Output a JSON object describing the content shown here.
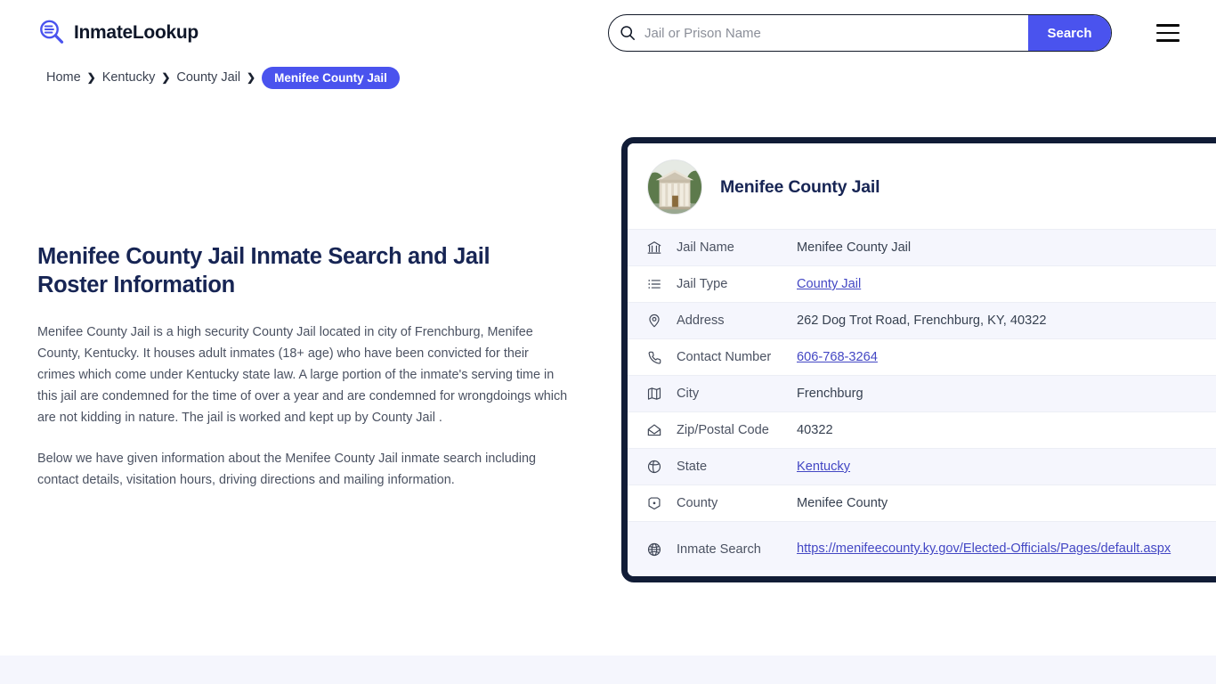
{
  "header": {
    "logo_text": "InmateLookup",
    "logo_icon": "magnifier-list-icon",
    "menu_icon": "hamburger-menu-icon"
  },
  "search": {
    "placeholder": "Jail or Prison Name",
    "value": "",
    "button_label": "Search",
    "icon": "search-icon"
  },
  "breadcrumb": {
    "items": [
      {
        "label": "Home"
      },
      {
        "label": "Kentucky"
      },
      {
        "label": "County Jail"
      }
    ],
    "separator": "❯",
    "current": "Menifee County Jail"
  },
  "main": {
    "title": "Menifee County Jail Inmate Search and Jail Roster Information",
    "paragraph_1": "Menifee County Jail is a high security County Jail located in city of Frenchburg, Menifee County, Kentucky. It houses adult inmates (18+ age) who have been convicted for their crimes which come under Kentucky state law. A large portion of the inmate's serving time in this jail are condemned for the time of over a year and are condemned for wrongdoings which are not kidding in nature. The jail is worked and kept up by County Jail .",
    "paragraph_2": "Below we have given information about the Menifee County Jail inmate search including contact details, visitation hours, driving directions and mailing information."
  },
  "info_card": {
    "title": "Menifee County Jail",
    "thumbnail_icon": "courthouse-photo",
    "rows": [
      {
        "icon": "bank-icon",
        "label": "Jail Name",
        "value": "Menifee County Jail",
        "link": false
      },
      {
        "icon": "list-icon",
        "label": "Jail Type",
        "value": "County Jail",
        "link": true
      },
      {
        "icon": "map-pin-icon",
        "label": "Address",
        "value": "262 Dog Trot Road, Frenchburg, KY, 40322",
        "link": false
      },
      {
        "icon": "phone-icon",
        "label": "Contact Number",
        "value": "606-768-3264",
        "link": true
      },
      {
        "icon": "map-icon",
        "label": "City",
        "value": "Frenchburg",
        "link": false
      },
      {
        "icon": "envelope-icon",
        "label": "Zip/Postal Code",
        "value": "40322",
        "link": false
      },
      {
        "icon": "globe-pin-icon",
        "label": "State",
        "value": "Kentucky",
        "link": true
      },
      {
        "icon": "county-icon",
        "label": "County",
        "value": "Menifee County",
        "link": false
      },
      {
        "icon": "globe-icon",
        "label": "Inmate Search",
        "value": "https://menifeecounty.ky.gov/Elected-Officials/Pages/default.aspx",
        "link": true
      }
    ]
  },
  "colors": {
    "accent": "#4a53ee",
    "card_border": "#111c36",
    "title": "#172554",
    "link": "#4347c4",
    "row_alt": "#f5f6fd",
    "body_text": "#4b5262"
  }
}
